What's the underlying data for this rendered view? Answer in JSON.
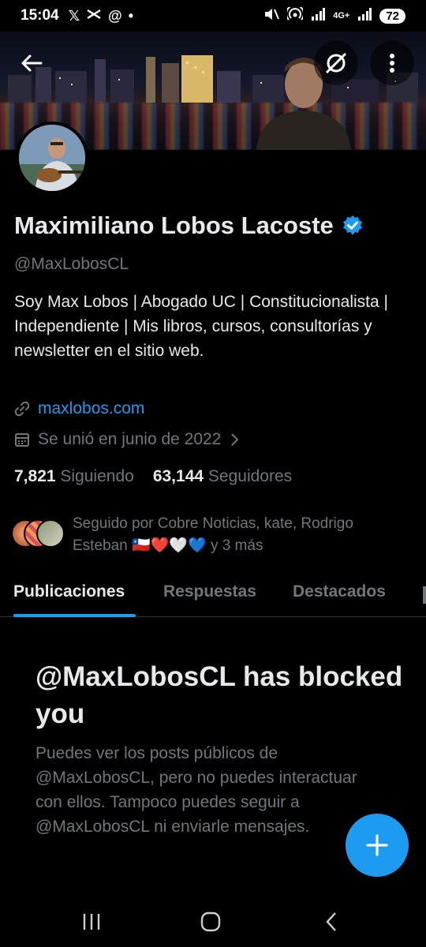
{
  "status_bar": {
    "time": "15:04",
    "left_icons": [
      "x-icon",
      "capcut-icon",
      "threads-icon",
      "dot-icon"
    ],
    "network": "4G+",
    "battery": "72"
  },
  "profile": {
    "name": "Maximiliano Lobos Lacoste",
    "verified": true,
    "handle": "@MaxLobosCL",
    "bio": "Soy Max Lobos | Abogado UC | Constitucionalista | Independiente | Mis libros, cursos, consultorías y newsletter en el sitio web.",
    "website": "maxlobos.com",
    "joined": "Se unió en junio de 2022",
    "following_count": "7,821",
    "following_label": "Siguiendo",
    "followers_count": "63,144",
    "followers_label": "Seguidores",
    "followed_by_line1": "Seguido por Cobre Noticias, kate, Rodrigo",
    "followed_by_line2_name": "Esteban",
    "followed_by_emojis": "🇨🇱❤️🤍💙",
    "followed_by_more": "y 3 más"
  },
  "tabs": [
    {
      "label": "Publicaciones",
      "active": true
    },
    {
      "label": "Respuestas",
      "active": false
    },
    {
      "label": "Destacados",
      "active": false
    }
  ],
  "blocked": {
    "title": "@MaxLobosCL has blocked you",
    "description": "Puedes ver los posts públicos de @MaxLobosCL, pero no puedes interactuar con ellos. Tampoco puedes seguir a @MaxLobosCL ni enviarle mensajes."
  },
  "colors": {
    "background": "#000000",
    "accent": "#1d9bf0",
    "text_primary": "#e7e9ea",
    "text_secondary": "#71767b"
  }
}
